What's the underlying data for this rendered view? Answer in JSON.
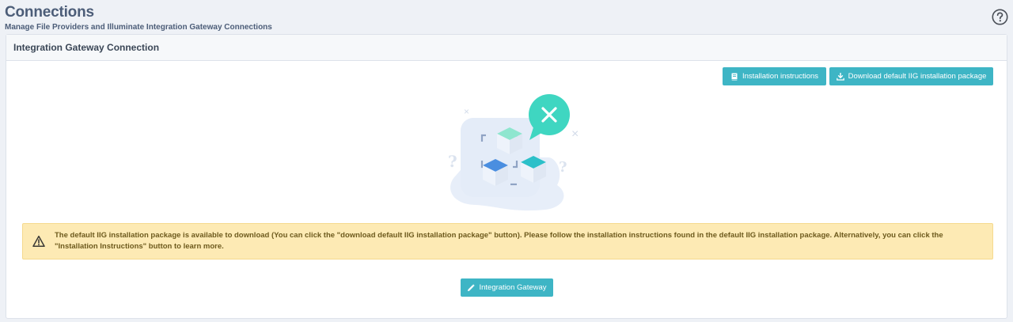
{
  "page": {
    "title": "Connections",
    "subtitle": "Manage File Providers and Illuminate Integration Gateway Connections",
    "help_icon": "question-circle-icon"
  },
  "card": {
    "title": "Integration Gateway Connection",
    "buttons": {
      "instructions": {
        "label": "Installation instructions",
        "icon": "book-icon"
      },
      "download": {
        "label": "Download default IIG installation package",
        "icon": "download-icon"
      },
      "gateway": {
        "label": "Integration Gateway",
        "icon": "pencil-icon"
      }
    },
    "illustration": "disconnected-cubes-illustration",
    "alert": {
      "icon": "warning-triangle-icon",
      "text": "The default IIG installation package is available to download (You can click the \"download default IIG installation package\" button). Please follow the installation instructions found in the default IIG installation package. Alternatively, you can click the \"Installation Instructions\" button to learn more."
    }
  },
  "colors": {
    "accent": "#3eb5c5",
    "alert_bg": "#fdeab4",
    "alert_text": "#6d5a1d",
    "title": "#4c5d78",
    "error_badge": "#3fd6c1"
  }
}
